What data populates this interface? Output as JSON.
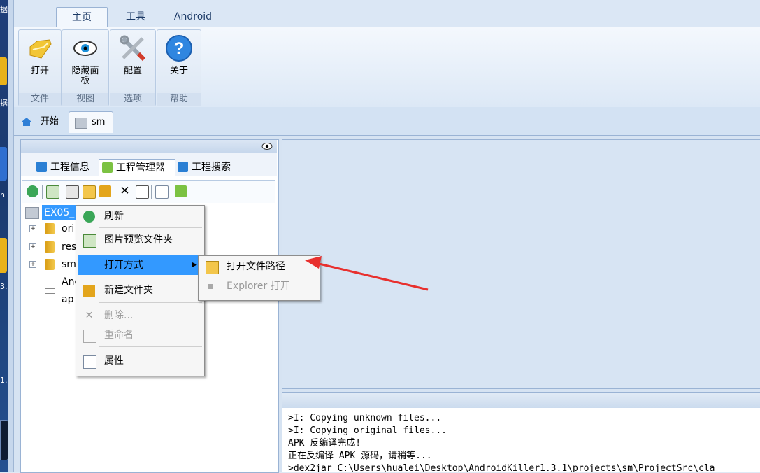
{
  "ribbon": {
    "tabs": [
      "主页",
      "工具",
      "Android"
    ],
    "groups": [
      {
        "button": "打开",
        "caption": "文件",
        "icon": "open-folder-icon"
      },
      {
        "button": "隐藏面板",
        "caption": "视图",
        "icon": "eye-icon"
      },
      {
        "button": "配置",
        "caption": "选项",
        "icon": "tools-icon"
      },
      {
        "button": "关于",
        "caption": "帮助",
        "icon": "help-icon"
      }
    ]
  },
  "doc_tabs": [
    "开始",
    "sm"
  ],
  "panel": {
    "tabs": [
      "工程信息",
      "工程管理器",
      "工程搜索"
    ]
  },
  "tree": {
    "root": "EX05_",
    "children": [
      "ori",
      "res",
      "sm",
      "And",
      "ap"
    ]
  },
  "context_menu": {
    "items": [
      "刷新",
      "图片预览文件夹",
      "打开方式",
      "新建文件夹",
      "删除...",
      "重命名",
      "属性"
    ],
    "submenu": [
      "打开文件路径",
      "Explorer 打开"
    ]
  },
  "console": {
    "lines": [
      ">I: Copying unknown files...",
      ">I: Copying original files...",
      "APK 反编译完成!",
      "正在反编译 APK 源码，请稍等...",
      ">dex2jar C:\\Users\\hualei\\Desktop\\AndroidKiller1.3.1\\projects\\sm\\ProjectSrc\\cla"
    ]
  },
  "desktop_fragments": [
    "据",
    "据",
    "n",
    "3.",
    "1."
  ],
  "colors": {
    "annotation_arrow": "#e8302e",
    "selection": "#3399ff"
  }
}
